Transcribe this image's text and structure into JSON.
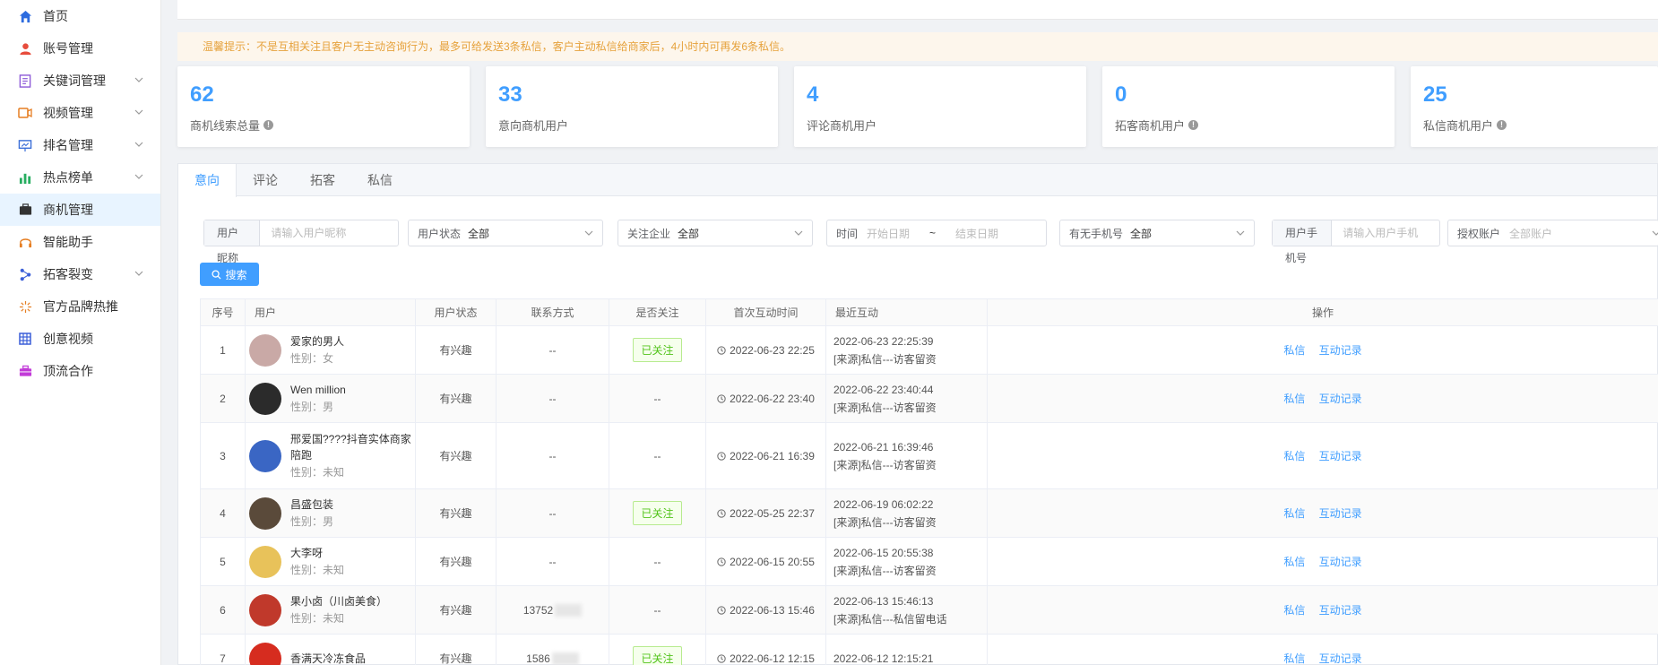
{
  "colors": {
    "accent": "#409eff",
    "notice_text": "#e6a23c",
    "followed": "#52c41a"
  },
  "sidebar": {
    "items": [
      {
        "label": "首页",
        "icon": "home-icon",
        "expandable": false
      },
      {
        "label": "账号管理",
        "icon": "user-icon",
        "expandable": false
      },
      {
        "label": "关键词管理",
        "icon": "document-icon",
        "expandable": true
      },
      {
        "label": "视频管理",
        "icon": "video-icon",
        "expandable": true
      },
      {
        "label": "排名管理",
        "icon": "presentation-icon",
        "expandable": true
      },
      {
        "label": "热点榜单",
        "icon": "bar-chart-icon",
        "expandable": true
      },
      {
        "label": "商机管理",
        "icon": "briefcase-icon",
        "expandable": false,
        "active": true
      },
      {
        "label": "智能助手",
        "icon": "headset-icon",
        "expandable": false
      },
      {
        "label": "拓客裂变",
        "icon": "share-icon",
        "expandable": true
      },
      {
        "label": "官方品牌热推",
        "icon": "sparkle-icon",
        "expandable": false
      },
      {
        "label": "创意视频",
        "icon": "film-grid-icon",
        "expandable": false
      },
      {
        "label": "顶流合作",
        "icon": "toolbox-icon",
        "expandable": false
      }
    ]
  },
  "notice": "温馨提示：不是互相关注且客户无主动咨询行为，最多可给发送3条私信，客户主动私信给商家后，4小时内可再发6条私信。",
  "stats": [
    {
      "value": "62",
      "label": "商机线索总量",
      "info": true
    },
    {
      "value": "33",
      "label": "意向商机用户",
      "info": false
    },
    {
      "value": "4",
      "label": "评论商机用户",
      "info": false
    },
    {
      "value": "0",
      "label": "拓客商机用户",
      "info": true
    },
    {
      "value": "25",
      "label": "私信商机用户",
      "info": true
    }
  ],
  "tabs": [
    "意向",
    "评论",
    "拓客",
    "私信"
  ],
  "filters": {
    "nickname_label": "用户昵称",
    "nickname_placeholder": "请输入用户昵称",
    "status_label": "用户状态",
    "status_value": "全部",
    "company_label": "关注企业",
    "company_value": "全部",
    "time_label": "时间",
    "time_start": "开始日期",
    "time_sep": "~",
    "time_end": "结束日期",
    "phone_has_label": "有无手机号",
    "phone_has_value": "全部",
    "phone_label": "用户手机号",
    "phone_placeholder": "请输入用户手机",
    "auth_label": "授权账户",
    "auth_value": "全部账户"
  },
  "search_button": "搜索",
  "table": {
    "headers": [
      "序号",
      "用户",
      "用户状态",
      "联系方式",
      "是否关注",
      "首次互动时间",
      "最近互动",
      "操作"
    ],
    "rows": [
      {
        "index": "1",
        "name": "爱家的男人",
        "gender": "性别：女",
        "status": "有兴趣",
        "contact": "--",
        "followed": "已关注",
        "first_time": "2022-06-23 22:25",
        "recent_time": "2022-06-23 22:25:39",
        "recent_src": "[来源]私信---访客留资",
        "avatar_color": "#c9a9a6"
      },
      {
        "index": "2",
        "name": "Wen million",
        "gender": "性别：男",
        "status": "有兴趣",
        "contact": "--",
        "followed": "--",
        "first_time": "2022-06-22 23:40",
        "recent_time": "2022-06-22 23:40:44",
        "recent_src": "[来源]私信---访客留资",
        "avatar_color": "#2b2b2b"
      },
      {
        "index": "3",
        "name": "邢爱国????抖音实体商家陪跑",
        "gender": "性别：未知",
        "status": "有兴趣",
        "contact": "--",
        "followed": "--",
        "first_time": "2022-06-21 16:39",
        "recent_time": "2022-06-21 16:39:46",
        "recent_src": "[来源]私信---访客留资",
        "avatar_color": "#3a66c4"
      },
      {
        "index": "4",
        "name": "昌盛包装",
        "gender": "性别：男",
        "status": "有兴趣",
        "contact": "--",
        "followed": "已关注",
        "first_time": "2022-05-25 22:37",
        "recent_time": "2022-06-19 06:02:22",
        "recent_src": "[来源]私信---访客留资",
        "avatar_color": "#5a4a3a"
      },
      {
        "index": "5",
        "name": "大李呀",
        "gender": "性别：未知",
        "status": "有兴趣",
        "contact": "--",
        "followed": "--",
        "first_time": "2022-06-15 20:55",
        "recent_time": "2022-06-15 20:55:38",
        "recent_src": "[来源]私信---访客留资",
        "avatar_color": "#e8c25a"
      },
      {
        "index": "6",
        "name": "果小卤（川卤美食）",
        "gender": "性别：未知",
        "status": "有兴趣",
        "contact": "13752",
        "followed": "--",
        "first_time": "2022-06-13 15:46",
        "recent_time": "2022-06-13 15:46:13",
        "recent_src": "[来源]私信---私信留电话",
        "avatar_color": "#c0392b"
      },
      {
        "index": "7",
        "name": "香满天冷冻食品",
        "gender": "",
        "status": "有兴趣",
        "contact": "1586",
        "followed": "已关注",
        "first_time": "2022-06-12 12:15",
        "recent_time": "2022-06-12 12:15:21",
        "recent_src": "",
        "avatar_color": "#d62c1f"
      }
    ],
    "ops": {
      "message": "私信",
      "history": "互动记录"
    }
  }
}
